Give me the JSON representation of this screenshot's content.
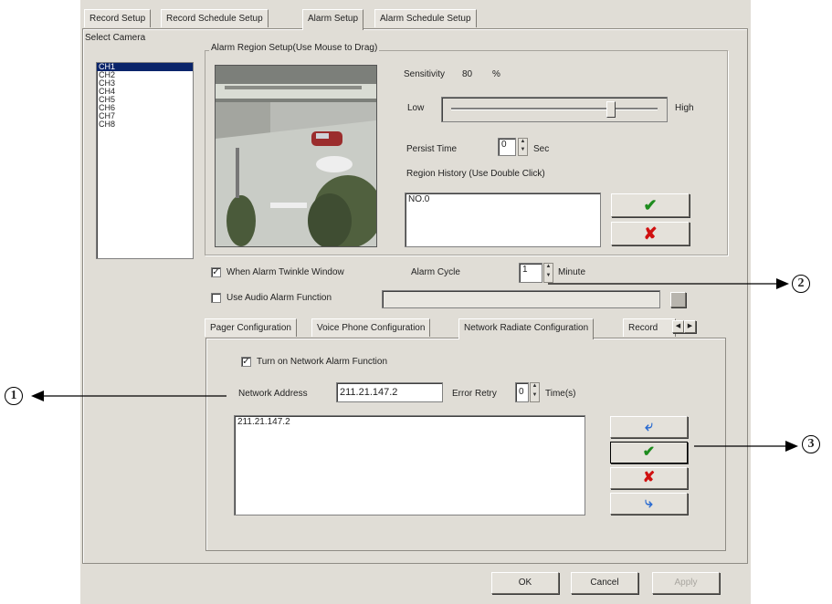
{
  "tabs": [
    "Record Setup",
    "Record Schedule Setup",
    "Alarm Setup",
    "Alarm Schedule Setup"
  ],
  "active_tab": "Alarm Setup",
  "select_camera": {
    "label": "Select Camera",
    "items": [
      "CH1",
      "CH2",
      "CH3",
      "CH4",
      "CH5",
      "CH6",
      "CH7",
      "CH8"
    ],
    "selected": "CH1"
  },
  "alarm_region": {
    "title": "Alarm Region Setup(Use Mouse to Drag)",
    "sensitivity_label": "Sensitivity",
    "sensitivity_value": "80",
    "sensitivity_unit": "%",
    "sensitivity_fraction": 0.8,
    "low_label": "Low",
    "high_label": "High",
    "persist_label": "Persist Time",
    "persist_value": "0",
    "persist_unit": "Sec",
    "history_label": "Region History (Use Double Click)",
    "history_items": [
      "NO.0"
    ]
  },
  "twinkle": {
    "label": "When Alarm Twinkle Window",
    "checked": true
  },
  "alarm_cycle": {
    "label": "Alarm Cycle",
    "value": "1",
    "unit": "Minute"
  },
  "audio": {
    "label": "Use Audio Alarm Function",
    "checked": false,
    "path": ""
  },
  "subtabs": [
    "Pager Configuration",
    "Voice Phone Configuration",
    "Network Radiate Configuration",
    "Record"
  ],
  "active_subtab": "Network Radiate Configuration",
  "network": {
    "enable_label": "Turn on Network Alarm Function",
    "enabled": true,
    "address_label": "Network Address",
    "address_value": "211.21.147.2",
    "retry_label": "Error Retry",
    "retry_value": "0",
    "retry_unit": "Time(s)",
    "list": [
      "211.21.147.2"
    ]
  },
  "buttons": {
    "ok": "OK",
    "cancel": "Cancel",
    "apply": "Apply"
  },
  "callouts": [
    "1",
    "2",
    "3"
  ],
  "colors": {
    "check": "#1e8c1e",
    "cross": "#d01010",
    "select": "#0a246a"
  }
}
